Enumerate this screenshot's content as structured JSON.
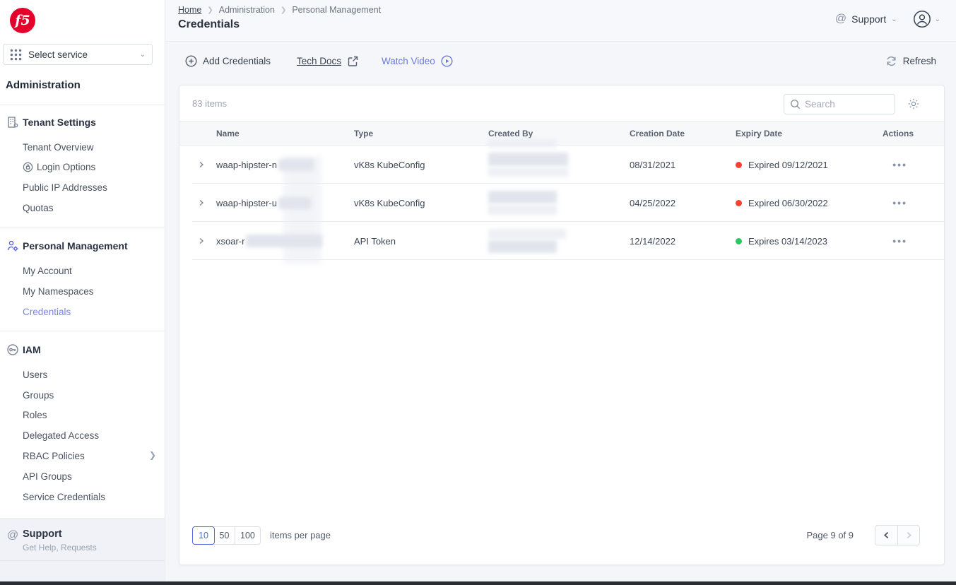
{
  "colors": {
    "accent": "#6b79e3",
    "logo_red": "#e4002b",
    "expired_dot": "#f8412f",
    "active_dot": "#2fc65f"
  },
  "sidebar": {
    "logo_text": "f5",
    "service_selector_label": "Select service",
    "heading": "Administration",
    "sections": [
      {
        "title": "Tenant Settings",
        "items": [
          "Tenant Overview",
          "Login Options",
          "Public IP Addresses",
          "Quotas"
        ]
      },
      {
        "title": "Personal Management",
        "items": [
          "My Account",
          "My Namespaces",
          "Credentials"
        ]
      },
      {
        "title": "IAM",
        "items": [
          "Users",
          "Groups",
          "Roles",
          "Delegated Access",
          "RBAC Policies",
          "API Groups",
          "Service Credentials"
        ]
      }
    ],
    "active_item": "Credentials",
    "support": {
      "title": "Support",
      "subtitle": "Get Help, Requests"
    }
  },
  "header": {
    "breadcrumb": [
      "Home",
      "Administration",
      "Personal Management"
    ],
    "title": "Credentials",
    "support_label": "Support"
  },
  "toolbar": {
    "add_label": "Add Credentials",
    "tech_docs_label": "Tech Docs",
    "watch_video_label": "Watch Video",
    "refresh_label": "Refresh"
  },
  "table": {
    "items_count": "83 items",
    "search_placeholder": "Search",
    "columns": [
      "Name",
      "Type",
      "Created By",
      "Creation Date",
      "Expiry Date",
      "Actions"
    ],
    "rows": [
      {
        "name": "waap-hipster-n",
        "type": "vK8s KubeConfig",
        "creation_date": "08/31/2021",
        "expiry": "Expired 09/12/2021",
        "status": "expired",
        "actions": "•••"
      },
      {
        "name": "waap-hipster-u",
        "type": "vK8s KubeConfig",
        "creation_date": "04/25/2022",
        "expiry": "Expired 06/30/2022",
        "status": "expired",
        "actions": "•••"
      },
      {
        "name": "xsoar-r",
        "type": "API Token",
        "creation_date": "12/14/2022",
        "expiry": "Expires 03/14/2023",
        "status": "active",
        "actions": "•••"
      }
    ]
  },
  "pagination": {
    "sizes": [
      "10",
      "50",
      "100"
    ],
    "active_size": "10",
    "per_page_label": "items per page",
    "page_label": "Page 9 of 9"
  }
}
